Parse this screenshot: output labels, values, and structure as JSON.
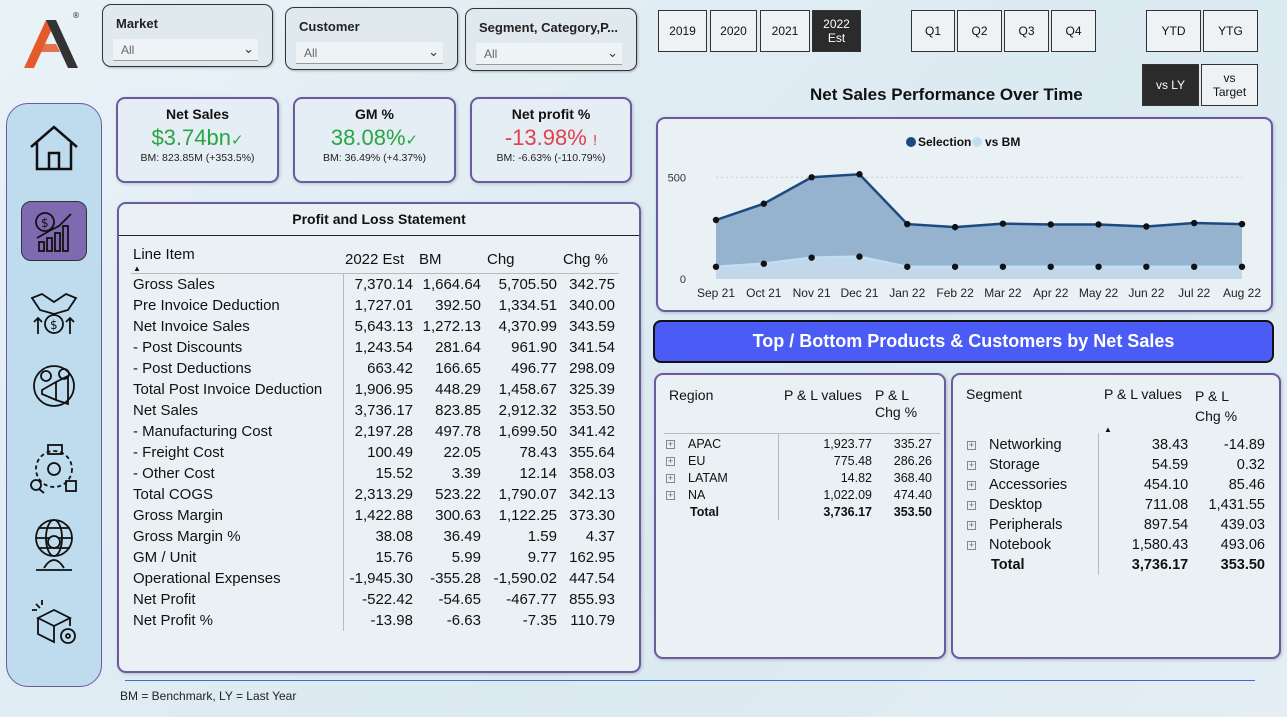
{
  "slicers": [
    {
      "label": "Market",
      "value": "All"
    },
    {
      "label": "Customer",
      "value": "All"
    },
    {
      "label": "Segment, Category,P...",
      "value": "All"
    }
  ],
  "years": [
    {
      "label": "2019"
    },
    {
      "label": "2020"
    },
    {
      "label": "2021"
    },
    {
      "label": "2022\nEst",
      "selected": true
    }
  ],
  "quarters": [
    {
      "label": "Q1"
    },
    {
      "label": "Q2"
    },
    {
      "label": "Q3"
    },
    {
      "label": "Q4"
    }
  ],
  "ytd": {
    "ytd": "YTD",
    "ytg": "YTG"
  },
  "compare": {
    "vs_ly": "vs LY",
    "vs_target": "vs\nTarget"
  },
  "nav_icons": [
    "home-icon",
    "finance-chart-icon",
    "sales-handshake-icon",
    "marketing-icon",
    "supply-chain-icon",
    "executive-globe-icon",
    "support-box-icon"
  ],
  "kpis": [
    {
      "title": "Net Sales",
      "value": "$3.74bn",
      "mark": "✓",
      "bm": "BM: 823.85M (+353.5%)",
      "color": "#2aa544"
    },
    {
      "title": "GM %",
      "value": "38.08%",
      "mark": "✓",
      "bm": "BM: 36.49% (+4.37%)",
      "color": "#2aa544"
    },
    {
      "title": "Net profit %",
      "value": "-13.98%",
      "mark": "!",
      "bm": "BM: -6.63% (-110.79%)",
      "color": "#e0414f"
    }
  ],
  "pl": {
    "title": "Profit and Loss Statement",
    "headers": [
      "Line Item",
      "2022 Est",
      "BM",
      "Chg",
      "Chg %"
    ],
    "rows": [
      [
        "Gross Sales",
        "7,370.14",
        "1,664.64",
        "5,705.50",
        "342.75"
      ],
      [
        "Pre Invoice Deduction",
        "1,727.01",
        "392.50",
        "1,334.51",
        "340.00"
      ],
      [
        "Net Invoice Sales",
        "5,643.13",
        "1,272.13",
        "4,370.99",
        "343.59"
      ],
      [
        "- Post Discounts",
        "1,243.54",
        "281.64",
        "961.90",
        "341.54"
      ],
      [
        "- Post Deductions",
        "663.42",
        "166.65",
        "496.77",
        "298.09"
      ],
      [
        "Total Post Invoice Deduction",
        "1,906.95",
        "448.29",
        "1,458.67",
        "325.39"
      ],
      [
        "Net Sales",
        "3,736.17",
        "823.85",
        "2,912.32",
        "353.50"
      ],
      [
        "- Manufacturing Cost",
        "2,197.28",
        "497.78",
        "1,699.50",
        "341.42"
      ],
      [
        "- Freight Cost",
        "100.49",
        "22.05",
        "78.43",
        "355.64"
      ],
      [
        "- Other Cost",
        "15.52",
        "3.39",
        "12.14",
        "358.03"
      ],
      [
        "Total COGS",
        "2,313.29",
        "523.22",
        "1,790.07",
        "342.13"
      ],
      [
        "Gross Margin",
        "1,422.88",
        "300.63",
        "1,122.25",
        "373.30"
      ],
      [
        "Gross Margin %",
        "38.08",
        "36.49",
        "1.59",
        "4.37"
      ],
      [
        "GM / Unit",
        "15.76",
        "5.99",
        "9.77",
        "162.95"
      ],
      [
        "Operational Expenses",
        "-1,945.30",
        "-355.28",
        "-1,590.02",
        "447.54"
      ],
      [
        "Net Profit",
        "-522.42",
        "-54.65",
        "-467.77",
        "855.93"
      ],
      [
        "Net Profit %",
        "-13.98",
        "-6.63",
        "-7.35",
        "110.79"
      ]
    ]
  },
  "chart_title": "Net Sales Performance Over Time",
  "chart_data": {
    "type": "area",
    "x": [
      "Sep 21",
      "Oct 21",
      "Nov 21",
      "Dec 21",
      "Jan 22",
      "Feb 22",
      "Mar 22",
      "Apr 22",
      "May 22",
      "Jun 22",
      "Jul 22",
      "Aug 22"
    ],
    "series": [
      {
        "name": "Selection",
        "values": [
          290,
          370,
          500,
          515,
          270,
          255,
          272,
          268,
          268,
          258,
          275,
          270
        ],
        "color": "#1c4a80"
      },
      {
        "name": "vs BM",
        "values": [
          60,
          75,
          105,
          110,
          60,
          60,
          60,
          60,
          60,
          60,
          60,
          60
        ],
        "color": "#bfe0f4"
      }
    ],
    "yticks": [
      0,
      500
    ],
    "ylim": [
      0,
      580
    ],
    "legend": "top"
  },
  "banner": "Top / Bottom Products & Customers by Net Sales",
  "region": {
    "headers": [
      "Region",
      "P & L values",
      "P & L\nChg %"
    ],
    "rows": [
      [
        "APAC",
        "1,923.77",
        "335.27"
      ],
      [
        "EU",
        "775.48",
        "286.26"
      ],
      [
        "LATAM",
        "14.82",
        "368.40"
      ],
      [
        "NA",
        "1,022.09",
        "474.40"
      ]
    ],
    "total": [
      "Total",
      "3,736.17",
      "353.50"
    ]
  },
  "segment": {
    "headers": [
      "Segment",
      "P & L values",
      "P & L\nChg %"
    ],
    "rows": [
      [
        "Networking",
        "38.43",
        "-14.89"
      ],
      [
        "Storage",
        "54.59",
        "0.32"
      ],
      [
        "Accessories",
        "454.10",
        "85.46"
      ],
      [
        "Desktop",
        "711.08",
        "1,431.55"
      ],
      [
        "Peripherals",
        "897.54",
        "439.03"
      ],
      [
        "Notebook",
        "1,580.43",
        "493.06"
      ]
    ],
    "total": [
      "Total",
      "3,736.17",
      "353.50"
    ]
  },
  "footer": "BM = Benchmark, LY = Last Year"
}
